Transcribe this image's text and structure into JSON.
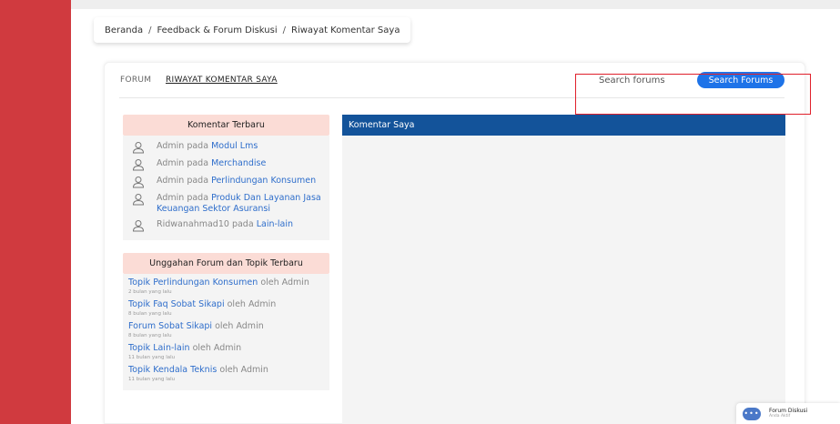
{
  "breadcrumb": {
    "home": "Beranda",
    "forum": "Feedback & Forum Diskusi",
    "current": "Riwayat Komentar Saya",
    "separator": "/"
  },
  "tabs": {
    "forum": "FORUM",
    "riwayat": "RIWAYAT KOMENTAR SAYA"
  },
  "search": {
    "placeholder": "Search forums",
    "button_label": "Search Forums"
  },
  "recent_comments": {
    "title": "Komentar Terbaru",
    "items": [
      {
        "author": "Admin",
        "prep": "pada",
        "topic": "Modul Lms",
        "icon": "user-icon"
      },
      {
        "author": "Admin",
        "prep": "pada",
        "topic": "Merchandise",
        "icon": "user-icon"
      },
      {
        "author": "Admin",
        "prep": "pada",
        "topic": "Perlindungan Konsumen",
        "icon": "user-icon"
      },
      {
        "author": "Admin",
        "prep": "pada",
        "topic": "Produk Dan Layanan Jasa Keuangan Sektor Asuransi",
        "icon": "user-icon"
      },
      {
        "author": "Ridwanahmad10",
        "prep": "pada",
        "topic": "Lain-lain",
        "icon": "user-icon"
      }
    ]
  },
  "recent_posts": {
    "title": "Unggahan Forum dan Topik Terbaru",
    "items": [
      {
        "title": "Topik Perlindungan Konsumen",
        "by": "oleh Admin",
        "time": "2 bulan yang lalu"
      },
      {
        "title": "Topik Faq Sobat Sikapi",
        "by": "oleh Admin",
        "time": "8 bulan yang lalu"
      },
      {
        "title": "Forum Sobat Sikapi",
        "by": "oleh Admin",
        "time": "8 bulan yang lalu"
      },
      {
        "title": "Topik Lain-lain",
        "by": "oleh Admin",
        "time": "11 bulan yang lalu"
      },
      {
        "title": "Topik Kendala Teknis",
        "by": "oleh Admin",
        "time": "11 bulan yang lalu"
      }
    ]
  },
  "my_comments": {
    "title": "Komentar Saya"
  },
  "chat": {
    "title": "Forum Diskusi",
    "status": "Anda Aktif",
    "icon": "ellipsis-icon"
  },
  "colors": {
    "sidebar": "#d03a3f",
    "accent_blue": "#1e73e8",
    "header_navy": "#13539a",
    "panel_pink": "#fbdcd6",
    "link_blue": "#2f6ecb",
    "highlight_red": "#e0202b"
  }
}
